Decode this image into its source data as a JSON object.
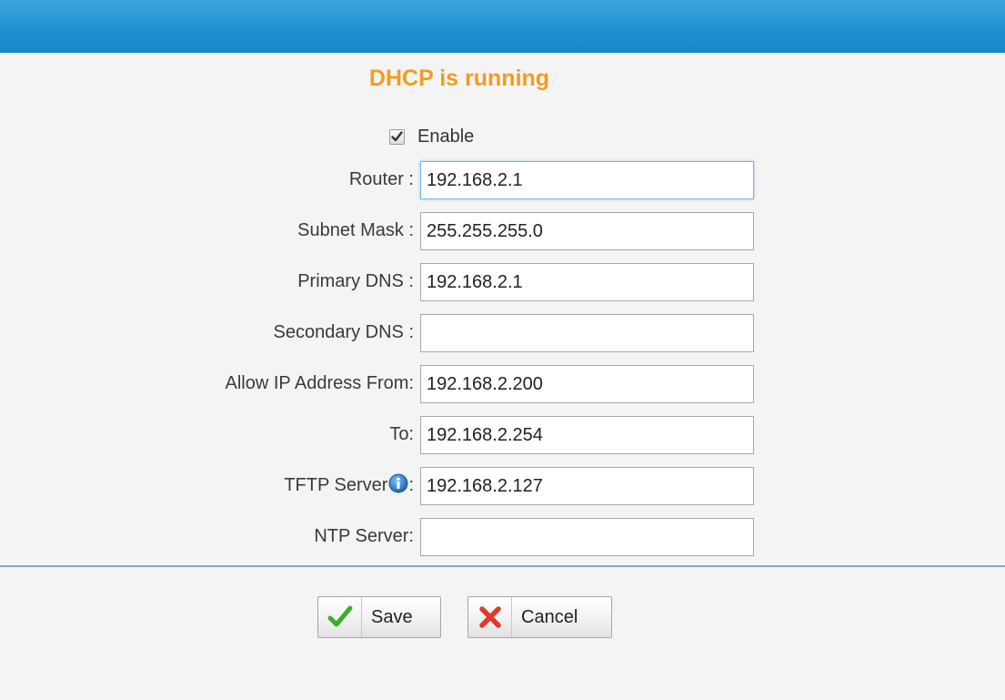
{
  "header": {
    "status_title": "DHCP is running"
  },
  "enable": {
    "label": "Enable",
    "checked": true
  },
  "fields": [
    {
      "label": "Router :",
      "value": "192.168.2.1"
    },
    {
      "label": "Subnet Mask :",
      "value": "255.255.255.0"
    },
    {
      "label": "Primary DNS :",
      "value": "192.168.2.1"
    },
    {
      "label": "Secondary DNS :",
      "value": ""
    },
    {
      "label": "Allow IP Address From:",
      "value": "192.168.2.200"
    },
    {
      "label": "To:",
      "value": "192.168.2.254"
    },
    {
      "label": "TFTP Server",
      "suffix": ":",
      "value": "192.168.2.127",
      "icon": "info-icon"
    },
    {
      "label": "NTP Server:",
      "value": ""
    }
  ],
  "buttons": {
    "save_label": "Save",
    "save_icon": "checkmark-icon",
    "cancel_label": "Cancel",
    "cancel_icon": "x-icon"
  },
  "colors": {
    "header_bar": "#1f8fd0",
    "status_title": "#f39c1f",
    "divider": "#8fa3c8",
    "save_check": "#3cae2a",
    "cancel_x": "#e0392b"
  }
}
